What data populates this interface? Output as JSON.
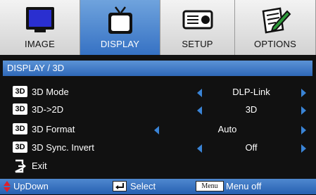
{
  "tabs": [
    {
      "label": "IMAGE",
      "icon": "monitor-icon",
      "active": false
    },
    {
      "label": "DISPLAY",
      "icon": "tv-icon",
      "active": true
    },
    {
      "label": "SETUP",
      "icon": "projector-icon",
      "active": false
    },
    {
      "label": "OPTIONS",
      "icon": "notepad-pencil-icon",
      "active": false
    }
  ],
  "header": {
    "title": "DISPLAY / 3D"
  },
  "rows": [
    {
      "badge": "3D",
      "label": "3D Mode",
      "value": "DLP-Link"
    },
    {
      "badge": "3D",
      "label": "3D->2D",
      "value": "3D"
    },
    {
      "badge": "3D",
      "label": "3D Format",
      "value": "Auto"
    },
    {
      "badge": "3D",
      "label": "3D Sync. Invert",
      "value": "Off"
    }
  ],
  "exit": {
    "label": "Exit"
  },
  "footer": {
    "updown": "UpDown",
    "select": "Select",
    "menu_key": "Menu",
    "menu_off": "Menu off"
  },
  "colors": {
    "accent": "#3a84d6",
    "header_bg": "#3f7ac7",
    "tab_active": "#4a86d0"
  }
}
